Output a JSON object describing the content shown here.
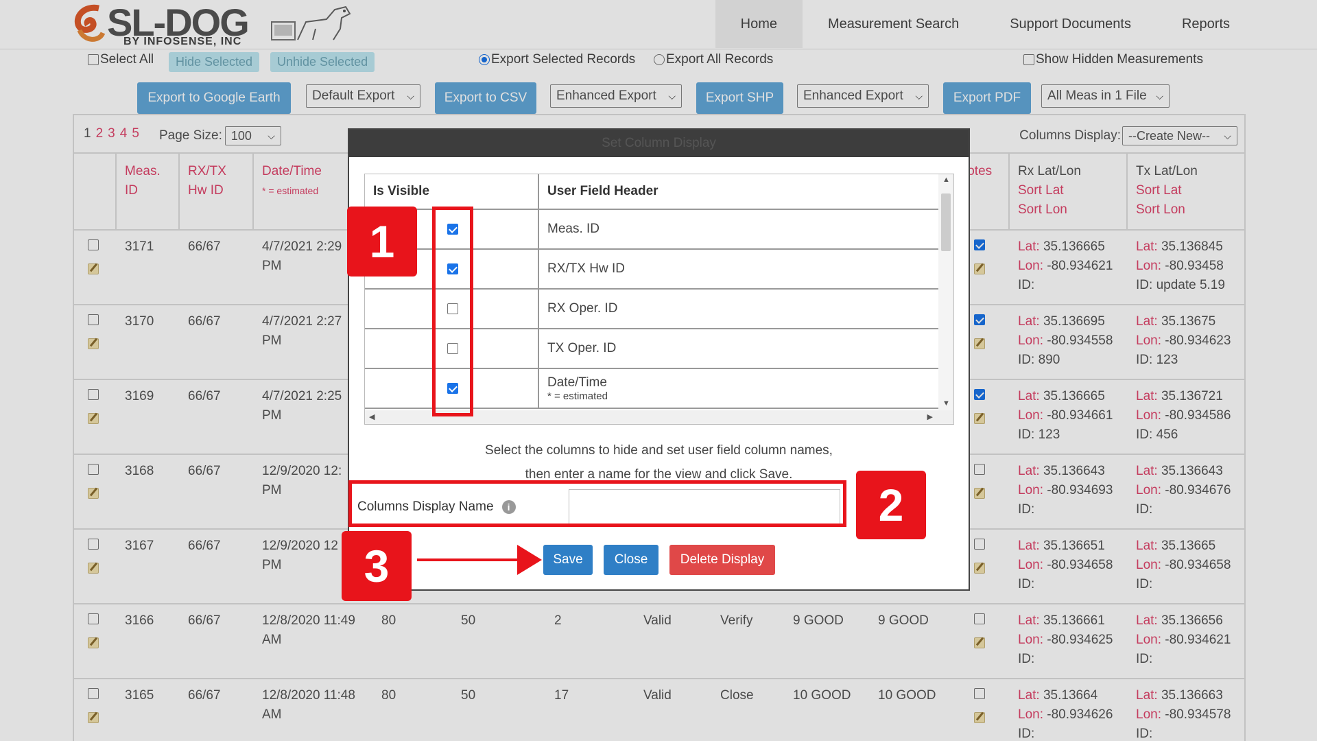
{
  "logo": {
    "main": "SL-DOG",
    "sub": "BY INFOSENSE, INC"
  },
  "nav": [
    "Home",
    "Measurement Search",
    "Support Documents",
    "Reports"
  ],
  "row1": {
    "select_all": "Select All",
    "hide_selected": "Hide Selected",
    "unhide_selected": "Unhide Selected",
    "export_selected": "Export Selected Records",
    "export_all": "Export All Records",
    "show_hidden": "Show Hidden Measurements"
  },
  "export_bar": {
    "google_earth": "Export to Google Earth",
    "default_export": "Default Export",
    "csv": "Export to CSV",
    "enhanced_export_1": "Enhanced Export",
    "shp": "Export SHP",
    "enhanced_export_2": "Enhanced Export",
    "pdf": "Export PDF",
    "all_meas": "All Meas in 1 File"
  },
  "pager": {
    "pages": [
      "1",
      "2",
      "3",
      "4",
      "5"
    ],
    "page_size_label": "Page Size:",
    "page_size_value": "100",
    "columns_display_label": "Columns Display:",
    "columns_display_value": "--Create New--"
  },
  "headers": {
    "meas_id": [
      "Meas.",
      "ID"
    ],
    "rxtx": [
      "RX/TX",
      "Hw ID"
    ],
    "datetime": "Date/Time",
    "estimated": "* = estimated",
    "notes": "lotes",
    "rx_latlon": [
      "Rx Lat/Lon",
      "Sort Lat",
      "Sort Lon"
    ],
    "tx_latlon": [
      "Tx Lat/Lon",
      "Sort Lat",
      "Sort Lon"
    ]
  },
  "labels": {
    "lat": "Lat:",
    "lon": "Lon:",
    "id": "ID:"
  },
  "rows": [
    {
      "id": "3171",
      "hw": "66/67",
      "dt1": "4/7/2021 2:29",
      "dt2": "PM",
      "c4": "",
      "c5": "",
      "c6": "",
      "c7": "",
      "c8": "",
      "c9": "",
      "c10": "",
      "notes": true,
      "rx_lat": "35.136665",
      "rx_lon": "-80.934621",
      "rx_id": "",
      "tx_lat": "35.136845",
      "tx_lon": "-80.93458",
      "tx_id": "update 5.19"
    },
    {
      "id": "3170",
      "hw": "66/67",
      "dt1": "4/7/2021 2:27",
      "dt2": "PM",
      "c4": "",
      "c5": "",
      "c6": "",
      "c7": "",
      "c8": "",
      "c9": "",
      "c10": "",
      "notes": true,
      "rx_lat": "35.136695",
      "rx_lon": "-80.934558",
      "rx_id": "890",
      "tx_lat": "35.13675",
      "tx_lon": "-80.934623",
      "tx_id": "123"
    },
    {
      "id": "3169",
      "hw": "66/67",
      "dt1": "4/7/2021 2:25",
      "dt2": "PM",
      "c4": "",
      "c5": "",
      "c6": "",
      "c7": "",
      "c8": "",
      "c9": "",
      "c10": "",
      "notes": true,
      "rx_lat": "35.136665",
      "rx_lon": "-80.934661",
      "rx_id": "123",
      "tx_lat": "35.136721",
      "tx_lon": "-80.934586",
      "tx_id": "456"
    },
    {
      "id": "3168",
      "hw": "66/67",
      "dt1": "12/9/2020 12:",
      "dt2": "PM",
      "c4": "",
      "c5": "",
      "c6": "",
      "c7": "",
      "c8": "",
      "c9": "",
      "c10": "",
      "notes": false,
      "rx_lat": "35.136643",
      "rx_lon": "-80.934693",
      "rx_id": "",
      "tx_lat": "35.136643",
      "tx_lon": "-80.934676",
      "tx_id": ""
    },
    {
      "id": "3167",
      "hw": "66/67",
      "dt1": "12/9/2020 12",
      "dt2": "PM",
      "c4": "",
      "c5": "",
      "c6": "",
      "c7": "",
      "c8": "",
      "c9": "",
      "c10": "",
      "notes": false,
      "rx_lat": "35.136651",
      "rx_lon": "-80.934658",
      "rx_id": "",
      "tx_lat": "35.13665",
      "tx_lon": "-80.934658",
      "tx_id": ""
    },
    {
      "id": "3166",
      "hw": "66/67",
      "dt1": "12/8/2020 11:49",
      "dt2": "AM",
      "c4": "80",
      "c5": "50",
      "c6": "2",
      "c7": "Valid",
      "c8": "Verify",
      "c9": "9  GOOD",
      "c10": "9  GOOD",
      "notes": false,
      "rx_lat": "35.136661",
      "rx_lon": "-80.934625",
      "rx_id": "",
      "tx_lat": "35.136656",
      "tx_lon": "-80.934621",
      "tx_id": ""
    },
    {
      "id": "3165",
      "hw": "66/67",
      "dt1": "12/8/2020 11:48",
      "dt2": "AM",
      "c4": "80",
      "c5": "50",
      "c6": "17",
      "c7": "Valid",
      "c8": "Close",
      "c9": "10  GOOD",
      "c10": "10  GOOD",
      "notes": false,
      "rx_lat": "35.13664",
      "rx_lon": "-80.934626",
      "rx_id": "",
      "tx_lat": "35.136663",
      "tx_lon": "-80.934578",
      "tx_id": ""
    }
  ],
  "modal": {
    "title": "Set Column Display",
    "col_visible": "Is Visible",
    "col_header": "User Field Header",
    "fields": [
      {
        "label": "Meas. ID",
        "checked": true
      },
      {
        "label": "RX/TX Hw ID",
        "checked": true
      },
      {
        "label": "RX Oper. ID",
        "checked": false
      },
      {
        "label": "TX Oper. ID",
        "checked": false
      },
      {
        "label": "Date/Time",
        "sub": "* = estimated",
        "checked": true
      }
    ],
    "hint_line1": "Select the columns to hide and set user field column names,",
    "hint_line2": "then enter a name for the view and click Save.",
    "name_label": "Columns Display Name",
    "name_value": "",
    "save": "Save",
    "close": "Close",
    "delete": "Delete Display"
  },
  "callouts": [
    "1",
    "2",
    "3"
  ],
  "colors": {
    "accent_link": "#e0456c",
    "button_blue": "#2f7fc6",
    "danger": "#e04848",
    "callout_red": "#e8141b"
  }
}
